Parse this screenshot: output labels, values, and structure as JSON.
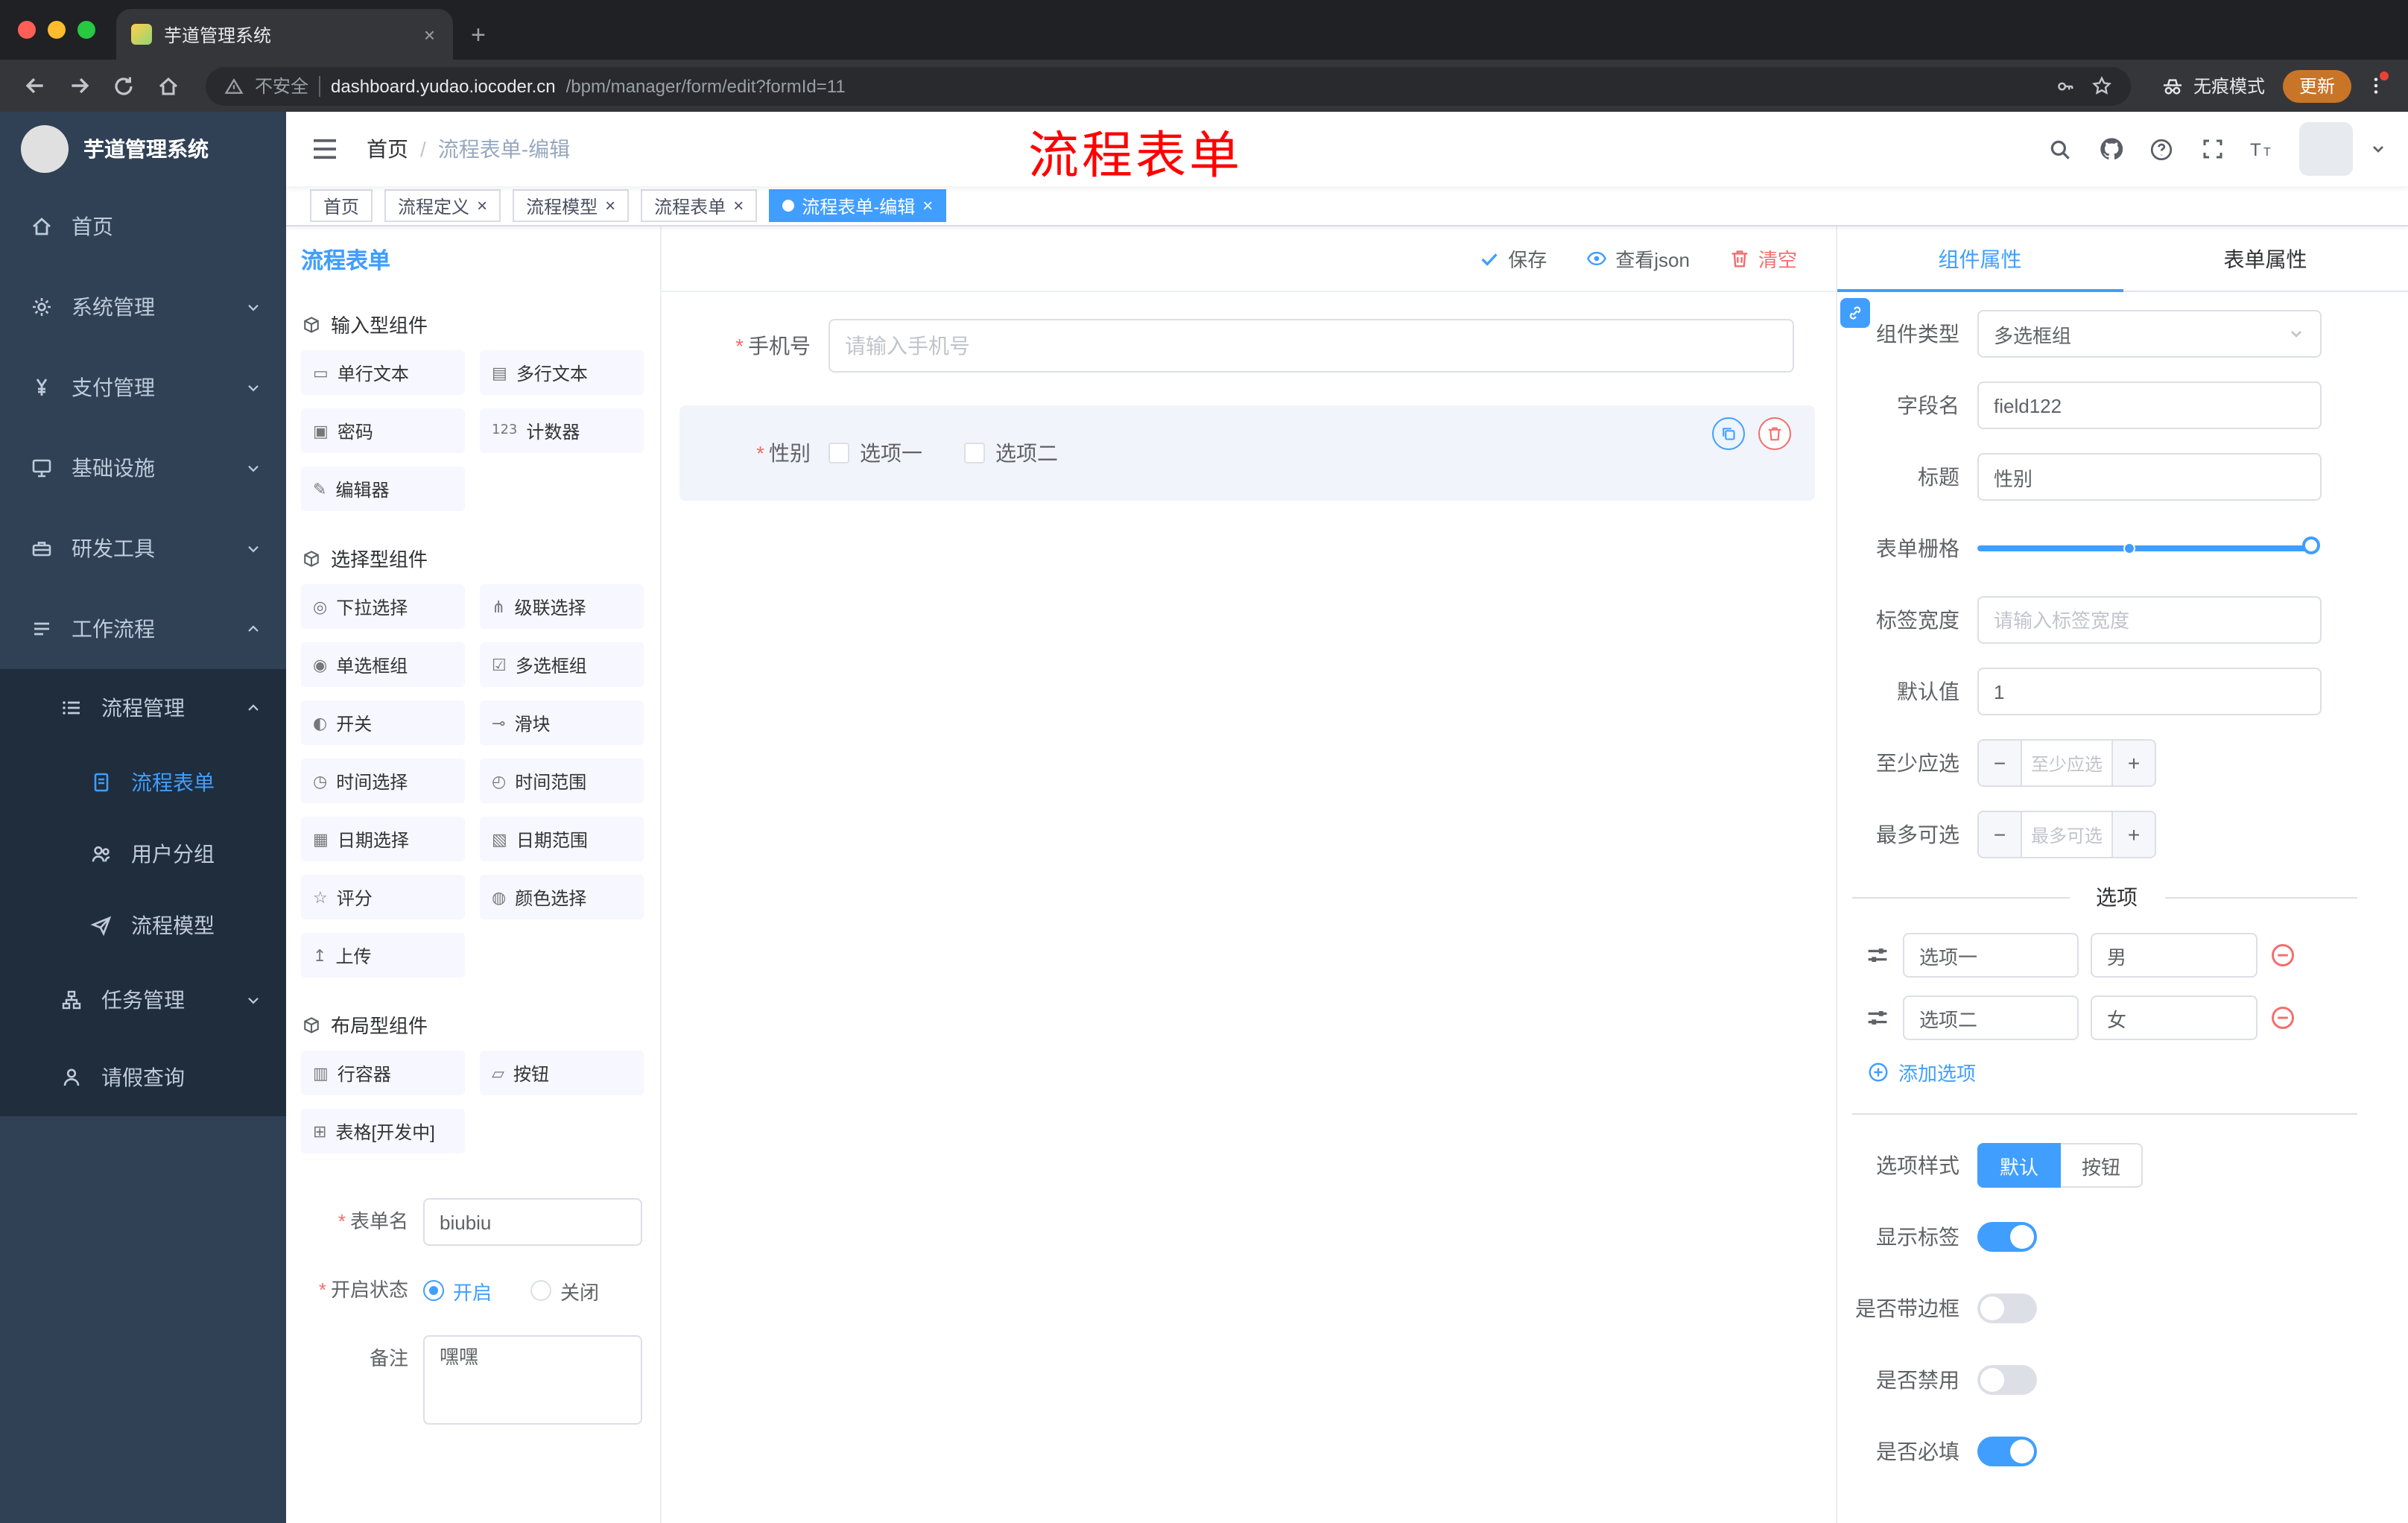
{
  "ui": {
    "required_mark": "*",
    "close_glyph": "×",
    "minus_glyph": "−",
    "plus_glyph": "+",
    "new_tab_glyph": "+",
    "question_glyph": "?"
  },
  "colors": {
    "primary": "#409EFF",
    "danger": "#F56C6C",
    "annotation": "#FF0000",
    "sidebar_bg": "#304156",
    "sidebar_submenu_bg": "#1F2D3D",
    "update_chip": "#C97528",
    "traffic_lights": [
      "#FF5F57",
      "#FEBC2E",
      "#28C840"
    ]
  },
  "browser": {
    "tab_title": "芋道管理系统",
    "security_label": "不安全",
    "url_domain": "dashboard.yudao.iocoder.cn",
    "url_path": "/bpm/manager/form/edit?formId=11",
    "incognito_label": "无痕模式",
    "update_label": "更新"
  },
  "sidebar": {
    "logo_title": "芋道管理系统",
    "items": [
      {
        "label": "首页"
      },
      {
        "label": "系统管理"
      },
      {
        "label": "支付管理"
      },
      {
        "label": "基础设施"
      },
      {
        "label": "研发工具"
      },
      {
        "label": "工作流程"
      },
      {
        "label": "流程管理"
      },
      {
        "label": "流程表单"
      },
      {
        "label": "用户分组"
      },
      {
        "label": "流程模型"
      },
      {
        "label": "任务管理"
      },
      {
        "label": "请假查询"
      }
    ]
  },
  "header": {
    "breadcrumb": [
      "首页",
      "流程表单-编辑"
    ],
    "breadcrumb_separator": "/",
    "annotation": "流程表单"
  },
  "tags": [
    {
      "label": "首页"
    },
    {
      "label": "流程定义"
    },
    {
      "label": "流程模型"
    },
    {
      "label": "流程表单"
    },
    {
      "label": "流程表单-编辑"
    }
  ],
  "palette": {
    "title": "流程表单",
    "groups": [
      {
        "name": "输入型组件",
        "items": [
          {
            "label": "单行文本",
            "icon": "single-line-text-icon",
            "glyph": "▭"
          },
          {
            "label": "多行文本",
            "icon": "textarea-icon",
            "glyph": "▤"
          },
          {
            "label": "密码",
            "icon": "lock-icon",
            "glyph": "▣"
          },
          {
            "label": "计数器",
            "icon": "counter-icon",
            "glyph": "123"
          },
          {
            "label": "编辑器",
            "icon": "editor-icon",
            "glyph": "✎"
          }
        ]
      },
      {
        "name": "选择型组件",
        "items": [
          {
            "label": "下拉选择",
            "icon": "select-icon",
            "glyph": "◎"
          },
          {
            "label": "级联选择",
            "icon": "cascader-icon",
            "glyph": "⋔"
          },
          {
            "label": "单选框组",
            "icon": "radio-group-icon",
            "glyph": "◉"
          },
          {
            "label": "多选框组",
            "icon": "checkbox-group-icon",
            "glyph": "☑"
          },
          {
            "label": "开关",
            "icon": "switch-icon",
            "glyph": "◐"
          },
          {
            "label": "滑块",
            "icon": "slider-icon",
            "glyph": "⊸"
          },
          {
            "label": "时间选择",
            "icon": "time-icon",
            "glyph": "◷"
          },
          {
            "label": "时间范围",
            "icon": "time-range-icon",
            "glyph": "◴"
          },
          {
            "label": "日期选择",
            "icon": "date-icon",
            "glyph": "▦"
          },
          {
            "label": "日期范围",
            "icon": "date-range-icon",
            "glyph": "▧"
          },
          {
            "label": "评分",
            "icon": "rate-icon",
            "glyph": "☆"
          },
          {
            "label": "颜色选择",
            "icon": "color-icon",
            "glyph": "◍"
          },
          {
            "label": "上传",
            "icon": "upload-icon",
            "glyph": "↥"
          }
        ]
      },
      {
        "name": "布局型组件",
        "items": [
          {
            "label": "行容器",
            "icon": "row-container-icon",
            "glyph": "▥"
          },
          {
            "label": "按钮",
            "icon": "button-icon",
            "glyph": "▱"
          },
          {
            "label": "表格[开发中]",
            "icon": "table-icon",
            "glyph": "⊞"
          }
        ]
      }
    ],
    "form": {
      "name_label": "表单名",
      "name_value": "biubiu",
      "status_label": "开启状态",
      "status_on": "开启",
      "status_off": "关闭",
      "remark_label": "备注",
      "remark_value": "嘿嘿"
    }
  },
  "canvas": {
    "actions": {
      "save": "保存",
      "view_json": "查看json",
      "clear": "清空"
    },
    "fields": [
      {
        "label": "手机号",
        "placeholder": "请输入手机号"
      },
      {
        "label": "性别",
        "options": [
          "选项一",
          "选项二"
        ]
      }
    ]
  },
  "props": {
    "tabs": [
      "组件属性",
      "表单属性"
    ],
    "component_type_label": "组件类型",
    "component_type_value": "多选框组",
    "field_name_label": "字段名",
    "field_name_value": "field122",
    "title_label": "标题",
    "title_value": "性别",
    "grid_label": "表单栅格",
    "label_width_label": "标签宽度",
    "label_width_placeholder": "请输入标签宽度",
    "default_label": "默认值",
    "default_value": "1",
    "min_label": "至少应选",
    "min_placeholder": "至少应选",
    "max_label": "最多可选",
    "max_placeholder": "最多可选",
    "options_title": "选项",
    "options": [
      {
        "label": "选项一",
        "value": "男"
      },
      {
        "label": "选项二",
        "value": "女"
      }
    ],
    "add_option": "添加选项",
    "style_label": "选项样式",
    "style_default": "默认",
    "style_button": "按钮",
    "switches": [
      {
        "label": "显示标签",
        "on": true
      },
      {
        "label": "是否带边框",
        "on": false
      },
      {
        "label": "是否禁用",
        "on": false
      },
      {
        "label": "是否必填",
        "on": true
      }
    ]
  }
}
